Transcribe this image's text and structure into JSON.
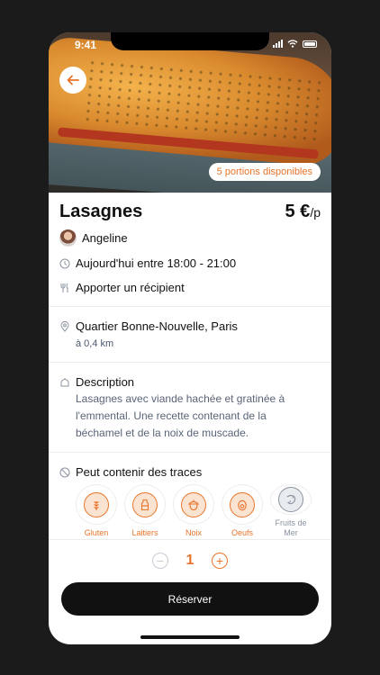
{
  "status_bar": {
    "time": "9:41"
  },
  "hero": {
    "portions_badge": "5 portions disponibles"
  },
  "dish": {
    "title": "Lasagnes",
    "price": "5 €",
    "price_unit": "/p",
    "cook_name": "Angeline",
    "schedule": "Aujourd'hui entre 18:00 - 21:00",
    "container_note": "Apporter un récipient"
  },
  "location": {
    "address": "Quartier Bonne-Nouvelle, Paris",
    "distance": "à 0,4 km"
  },
  "description": {
    "heading": "Description",
    "text": "Lasagnes avec viande hachée et gratinée à l'emmental. Une recette contenant de la béchamel et de la noix de muscade."
  },
  "allergens": {
    "heading": "Peut contenir des traces",
    "items": [
      {
        "label": "Gluten",
        "icon": "wheat-icon"
      },
      {
        "label": "Laitiers",
        "icon": "milk-icon"
      },
      {
        "label": "Noix",
        "icon": "nut-icon"
      },
      {
        "label": "Oeufs",
        "icon": "egg-icon"
      },
      {
        "label": "Fruits de Mer",
        "icon": "shrimp-icon"
      }
    ]
  },
  "quantity": {
    "value": "1",
    "minus": "−",
    "plus": "+"
  },
  "actions": {
    "reserve_label": "Réserver"
  },
  "colors": {
    "accent": "#e8742a",
    "button": "#111111",
    "muted": "#5a6478"
  }
}
